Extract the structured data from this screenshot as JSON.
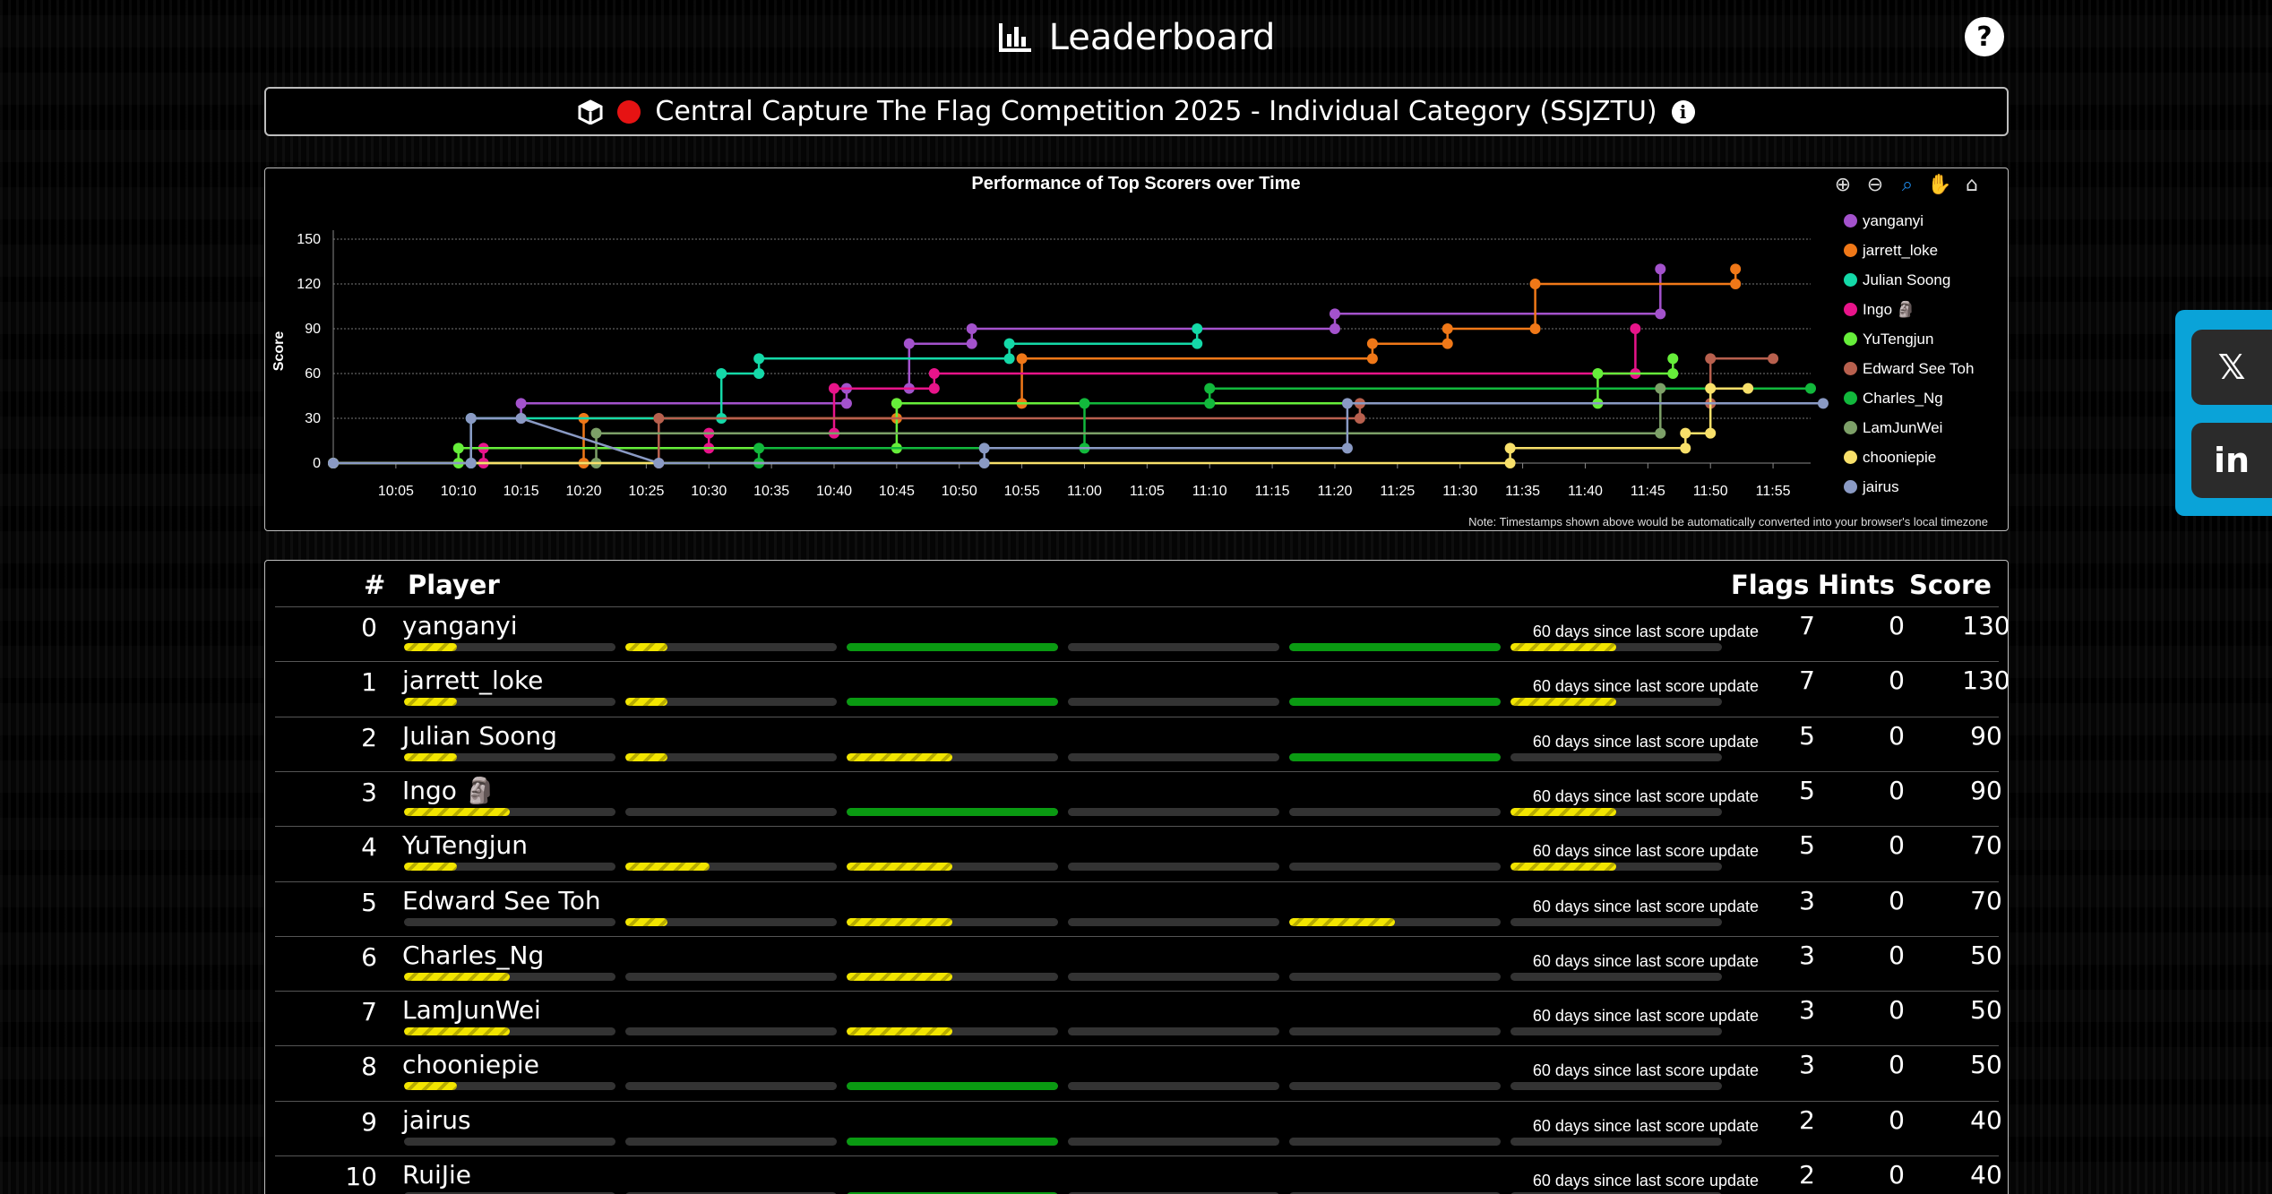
{
  "header": {
    "title": "Leaderboard",
    "title_icon": "chart-bar-icon",
    "help_label": "?"
  },
  "competition": {
    "title": "Central Capture The Flag Competition 2025 - Individual Category (SSJZTU)",
    "status_color": "#e61313"
  },
  "chart": {
    "toolbar": [
      "zoom-in-icon",
      "zoom-out-icon",
      "zoom-select-icon",
      "pan-icon",
      "reset-zoom-icon"
    ],
    "note": "Note: Timestamps shown above would be automatically converted into your browser's local timezone"
  },
  "chart_data": {
    "type": "line",
    "title": "Performance of Top Scorers over Time",
    "xlabel": "",
    "ylabel": "Score",
    "ylim": [
      0,
      150
    ],
    "yticks": [
      0,
      30,
      60,
      90,
      120,
      150
    ],
    "xlim": [
      "10:00",
      "11:58"
    ],
    "xticks": [
      "10:05",
      "10:10",
      "10:15",
      "10:20",
      "10:25",
      "10:30",
      "10:35",
      "10:40",
      "10:45",
      "10:50",
      "10:55",
      "11:00",
      "11:05",
      "11:10",
      "11:15",
      "11:20",
      "11:25",
      "11:30",
      "11:35",
      "11:40",
      "11:45",
      "11:50",
      "11:55"
    ],
    "grid": "horizontal",
    "legend_position": "right",
    "series": [
      {
        "name": "yanganyi",
        "color": "#a352cc",
        "points": [
          [
            "10:00",
            0
          ],
          [
            "10:11",
            0
          ],
          [
            "10:11",
            30
          ],
          [
            "10:15",
            30
          ],
          [
            "10:15",
            40
          ],
          [
            "10:41",
            40
          ],
          [
            "10:41",
            50
          ],
          [
            "10:46",
            50
          ],
          [
            "10:46",
            80
          ],
          [
            "10:51",
            80
          ],
          [
            "10:51",
            90
          ],
          [
            "11:20",
            90
          ],
          [
            "11:20",
            100
          ],
          [
            "11:46",
            100
          ],
          [
            "11:46",
            130
          ]
        ]
      },
      {
        "name": "jarrett_loke",
        "color": "#f07818",
        "points": [
          [
            "10:00",
            0
          ],
          [
            "10:20",
            0
          ],
          [
            "10:20",
            30
          ],
          [
            "10:45",
            30
          ],
          [
            "10:45",
            40
          ],
          [
            "10:55",
            40
          ],
          [
            "10:55",
            70
          ],
          [
            "11:23",
            70
          ],
          [
            "11:23",
            80
          ],
          [
            "11:29",
            80
          ],
          [
            "11:29",
            90
          ],
          [
            "11:36",
            90
          ],
          [
            "11:36",
            120
          ],
          [
            "11:52",
            120
          ],
          [
            "11:52",
            130
          ]
        ]
      },
      {
        "name": "Julian Soong",
        "color": "#14d9a8",
        "points": [
          [
            "10:00",
            0
          ],
          [
            "10:11",
            0
          ],
          [
            "10:11",
            30
          ],
          [
            "10:31",
            30
          ],
          [
            "10:31",
            60
          ],
          [
            "10:34",
            60
          ],
          [
            "10:34",
            70
          ],
          [
            "10:54",
            70
          ],
          [
            "10:54",
            80
          ],
          [
            "11:09",
            80
          ],
          [
            "11:09",
            90
          ]
        ]
      },
      {
        "name": "Ingo 🗿",
        "color": "#e8148a",
        "points": [
          [
            "10:00",
            0
          ],
          [
            "10:12",
            0
          ],
          [
            "10:12",
            10
          ],
          [
            "10:30",
            10
          ],
          [
            "10:30",
            20
          ],
          [
            "10:40",
            20
          ],
          [
            "10:40",
            50
          ],
          [
            "10:48",
            50
          ],
          [
            "10:48",
            60
          ],
          [
            "11:44",
            60
          ],
          [
            "11:44",
            90
          ]
        ]
      },
      {
        "name": "YuTengjun",
        "color": "#66ee3a",
        "points": [
          [
            "10:00",
            0
          ],
          [
            "10:10",
            0
          ],
          [
            "10:10",
            10
          ],
          [
            "10:45",
            10
          ],
          [
            "10:45",
            40
          ],
          [
            "11:41",
            40
          ],
          [
            "11:41",
            60
          ],
          [
            "11:47",
            60
          ],
          [
            "11:47",
            70
          ]
        ]
      },
      {
        "name": "Edward See Toh",
        "color": "#b8604e",
        "points": [
          [
            "10:00",
            0
          ],
          [
            "10:26",
            0
          ],
          [
            "10:26",
            30
          ],
          [
            "11:22",
            30
          ],
          [
            "11:22",
            40
          ],
          [
            "11:50",
            40
          ],
          [
            "11:50",
            70
          ],
          [
            "11:55",
            70
          ]
        ]
      },
      {
        "name": "Charles_Ng",
        "color": "#12b83c",
        "points": [
          [
            "10:00",
            0
          ],
          [
            "10:34",
            0
          ],
          [
            "10:34",
            10
          ],
          [
            "11:00",
            10
          ],
          [
            "11:00",
            40
          ],
          [
            "11:10",
            40
          ],
          [
            "11:10",
            50
          ],
          [
            "11:58",
            50
          ]
        ]
      },
      {
        "name": "LamJunWei",
        "color": "#7da068",
        "points": [
          [
            "10:00",
            0
          ],
          [
            "10:21",
            0
          ],
          [
            "10:21",
            20
          ],
          [
            "11:46",
            20
          ],
          [
            "11:46",
            50
          ]
        ]
      },
      {
        "name": "chooniepie",
        "color": "#f8e06a",
        "points": [
          [
            "10:00",
            0
          ],
          [
            "11:34",
            0
          ],
          [
            "11:34",
            10
          ],
          [
            "11:48",
            10
          ],
          [
            "11:48",
            20
          ],
          [
            "11:50",
            20
          ],
          [
            "11:50",
            50
          ],
          [
            "11:53",
            50
          ]
        ]
      },
      {
        "name": "jairus",
        "color": "#8a9ac4",
        "points": [
          [
            "10:00",
            0
          ],
          [
            "10:11",
            0
          ],
          [
            "10:11",
            30
          ],
          [
            "10:15",
            30
          ],
          [
            "10:26",
            0
          ],
          [
            "10:52",
            0
          ],
          [
            "10:52",
            10
          ],
          [
            "11:21",
            10
          ],
          [
            "11:21",
            40
          ],
          [
            "11:59",
            40
          ]
        ]
      }
    ]
  },
  "table": {
    "headers": {
      "rank": "#",
      "player": "Player",
      "flags": "Flags",
      "hints": "Hints",
      "score": "Score"
    },
    "rows": [
      {
        "rank": "0",
        "player": "yanganyi",
        "update": "60 days since last score update",
        "flags": "7",
        "hints": "0",
        "score": "130",
        "progress": [
          [
            "yellow",
            0.25
          ],
          [
            "yellow",
            0.2
          ],
          [
            "green",
            1
          ],
          [
            "none",
            0
          ],
          [
            "green",
            1
          ],
          [
            "yellow",
            0.5
          ]
        ]
      },
      {
        "rank": "1",
        "player": "jarrett_loke",
        "update": "60 days since last score update",
        "flags": "7",
        "hints": "0",
        "score": "130",
        "progress": [
          [
            "yellow",
            0.25
          ],
          [
            "yellow",
            0.2
          ],
          [
            "green",
            1
          ],
          [
            "none",
            0
          ],
          [
            "green",
            1
          ],
          [
            "yellow",
            0.5
          ]
        ]
      },
      {
        "rank": "2",
        "player": "Julian Soong",
        "update": "60 days since last score update",
        "flags": "5",
        "hints": "0",
        "score": "90",
        "progress": [
          [
            "yellow",
            0.25
          ],
          [
            "yellow",
            0.2
          ],
          [
            "yellow",
            0.5
          ],
          [
            "none",
            0
          ],
          [
            "green",
            1
          ],
          [
            "none",
            0
          ]
        ]
      },
      {
        "rank": "3",
        "player": "Ingo 🗿",
        "update": "60 days since last score update",
        "flags": "5",
        "hints": "0",
        "score": "90",
        "progress": [
          [
            "yellow",
            0.5
          ],
          [
            "none",
            0
          ],
          [
            "green",
            1
          ],
          [
            "none",
            0
          ],
          [
            "none",
            0
          ],
          [
            "yellow",
            0.5
          ]
        ]
      },
      {
        "rank": "4",
        "player": "YuTengjun",
        "update": "60 days since last score update",
        "flags": "5",
        "hints": "0",
        "score": "70",
        "progress": [
          [
            "yellow",
            0.25
          ],
          [
            "yellow",
            0.4
          ],
          [
            "yellow",
            0.5
          ],
          [
            "none",
            0
          ],
          [
            "none",
            0
          ],
          [
            "yellow",
            0.5
          ]
        ]
      },
      {
        "rank": "5",
        "player": "Edward See Toh",
        "update": "60 days since last score update",
        "flags": "3",
        "hints": "0",
        "score": "70",
        "progress": [
          [
            "none",
            0
          ],
          [
            "yellow",
            0.2
          ],
          [
            "yellow",
            0.5
          ],
          [
            "none",
            0
          ],
          [
            "yellow",
            0.5
          ],
          [
            "none",
            0
          ]
        ]
      },
      {
        "rank": "6",
        "player": "Charles_Ng",
        "update": "60 days since last score update",
        "flags": "3",
        "hints": "0",
        "score": "50",
        "progress": [
          [
            "yellow",
            0.5
          ],
          [
            "none",
            0
          ],
          [
            "yellow",
            0.5
          ],
          [
            "none",
            0
          ],
          [
            "none",
            0
          ],
          [
            "none",
            0
          ]
        ]
      },
      {
        "rank": "7",
        "player": "LamJunWei",
        "update": "60 days since last score update",
        "flags": "3",
        "hints": "0",
        "score": "50",
        "progress": [
          [
            "yellow",
            0.5
          ],
          [
            "none",
            0
          ],
          [
            "yellow",
            0.5
          ],
          [
            "none",
            0
          ],
          [
            "none",
            0
          ],
          [
            "none",
            0
          ]
        ]
      },
      {
        "rank": "8",
        "player": "chooniepie",
        "update": "60 days since last score update",
        "flags": "3",
        "hints": "0",
        "score": "50",
        "progress": [
          [
            "yellow",
            0.25
          ],
          [
            "none",
            0
          ],
          [
            "green",
            1
          ],
          [
            "none",
            0
          ],
          [
            "none",
            0
          ],
          [
            "none",
            0
          ]
        ]
      },
      {
        "rank": "9",
        "player": "jairus",
        "update": "60 days since last score update",
        "flags": "2",
        "hints": "0",
        "score": "40",
        "progress": [
          [
            "none",
            0
          ],
          [
            "none",
            0
          ],
          [
            "green",
            1
          ],
          [
            "none",
            0
          ],
          [
            "none",
            0
          ],
          [
            "none",
            0
          ]
        ]
      },
      {
        "rank": "10",
        "player": "RuiJie",
        "update": "60 days since last score update",
        "flags": "2",
        "hints": "0",
        "score": "40",
        "progress": [
          [
            "none",
            0
          ],
          [
            "none",
            0
          ],
          [
            "green",
            1
          ],
          [
            "none",
            0
          ],
          [
            "none",
            0
          ],
          [
            "none",
            0
          ]
        ]
      }
    ]
  },
  "social": [
    {
      "icon": "x-icon",
      "label": "𝕏"
    },
    {
      "icon": "linkedin-icon",
      "label": "in"
    }
  ]
}
